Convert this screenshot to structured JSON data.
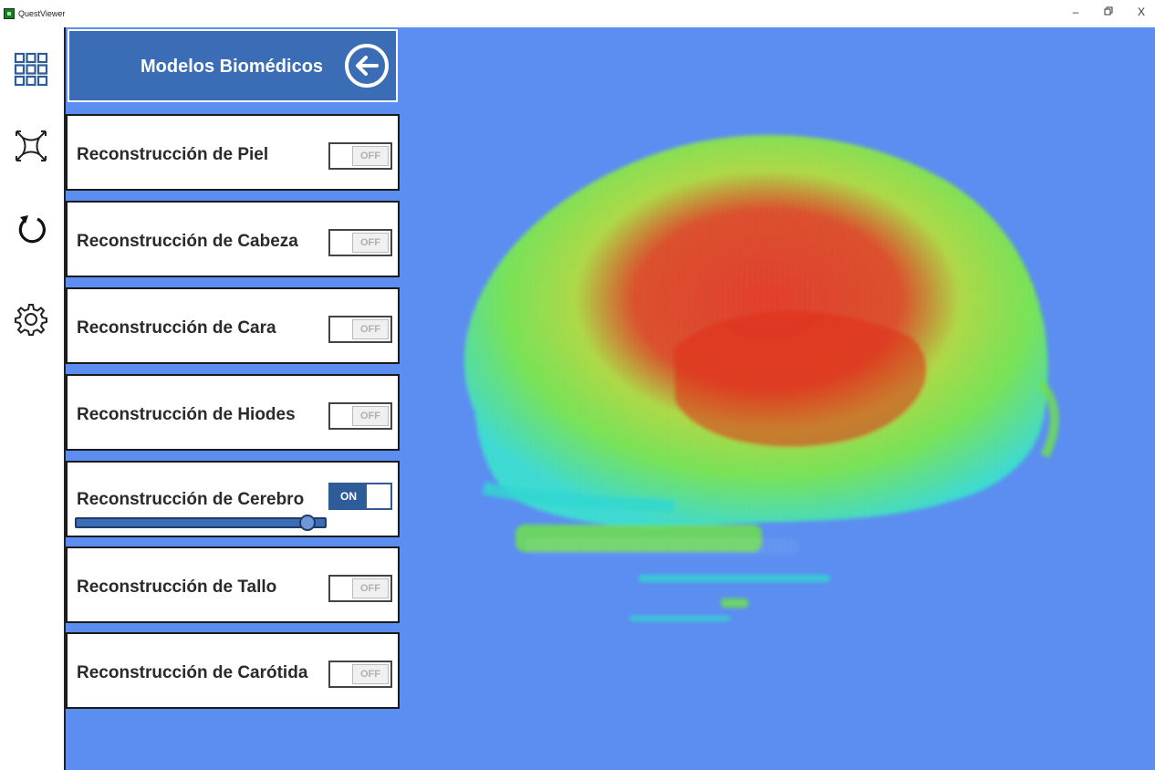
{
  "window": {
    "title": "QuestViewer",
    "controls": {
      "minimize": "–",
      "restore": "🗗",
      "close": "X"
    }
  },
  "toolbar": {
    "items": [
      {
        "name": "grid-menu",
        "icon": "grid-icon"
      },
      {
        "name": "fit-view",
        "icon": "expand-corners-icon"
      },
      {
        "name": "reset-rotation",
        "icon": "rotate-icon"
      },
      {
        "name": "settings",
        "icon": "gear-icon"
      }
    ]
  },
  "panel": {
    "title": "Modelos Biomédicos",
    "back_icon": "arrow-left-icon",
    "items": [
      {
        "label": "Reconstrucción de Piel",
        "state": "OFF"
      },
      {
        "label": "Reconstrucción de Cabeza",
        "state": "OFF"
      },
      {
        "label": "Reconstrucción de Cara",
        "state": "OFF"
      },
      {
        "label": "Reconstrucción de Hiodes",
        "state": "OFF"
      },
      {
        "label": "Reconstrucción de Cerebro",
        "state": "ON",
        "slider_value": 0.93
      },
      {
        "label": "Reconstrucción de Tallo",
        "state": "OFF"
      },
      {
        "label": "Reconstrucción de Carótida",
        "state": "OFF"
      }
    ]
  },
  "colors": {
    "background": "#5b8ef0",
    "panel_header": "#3a6db5",
    "toggle_on": "#2e5c99",
    "heat_low": "#2fd7d0",
    "heat_mid": "#7be04a",
    "heat_high": "#e0301a"
  }
}
